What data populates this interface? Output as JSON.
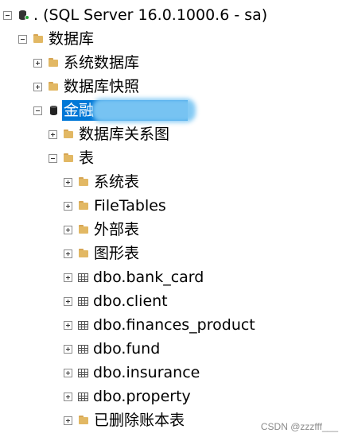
{
  "tree": {
    "server": {
      "label": ". (SQL Server 16.0.1000.6 - sa)",
      "icon": "server-icon"
    },
    "databases": {
      "label": "数据库",
      "icon": "folder-icon"
    },
    "system_databases": {
      "label": "系统数据库",
      "icon": "folder-icon"
    },
    "snapshots": {
      "label": "数据库快照",
      "icon": "folder-icon"
    },
    "database": {
      "label": "金融",
      "icon": "database-icon",
      "selected": true
    },
    "diagrams": {
      "label": "数据库关系图",
      "icon": "folder-icon"
    },
    "tables": {
      "label": "表",
      "icon": "folder-icon"
    },
    "table_items": [
      {
        "label": "系统表",
        "icon": "folder-icon"
      },
      {
        "label": "FileTables",
        "icon": "folder-icon"
      },
      {
        "label": "外部表",
        "icon": "folder-icon"
      },
      {
        "label": "图形表",
        "icon": "folder-icon"
      },
      {
        "label": "dbo.bank_card",
        "icon": "table-icon"
      },
      {
        "label": "dbo.client",
        "icon": "table-icon"
      },
      {
        "label": "dbo.finances_product",
        "icon": "table-icon"
      },
      {
        "label": "dbo.fund",
        "icon": "table-icon"
      },
      {
        "label": "dbo.insurance",
        "icon": "table-icon"
      },
      {
        "label": "dbo.property",
        "icon": "table-icon"
      },
      {
        "label": "已删除账本表",
        "icon": "folder-icon"
      }
    ]
  },
  "colors": {
    "selection": "#0078d7",
    "folder": "#e2b864",
    "status_running": "#21a333"
  },
  "watermark": "CSDN @zzzfff___"
}
